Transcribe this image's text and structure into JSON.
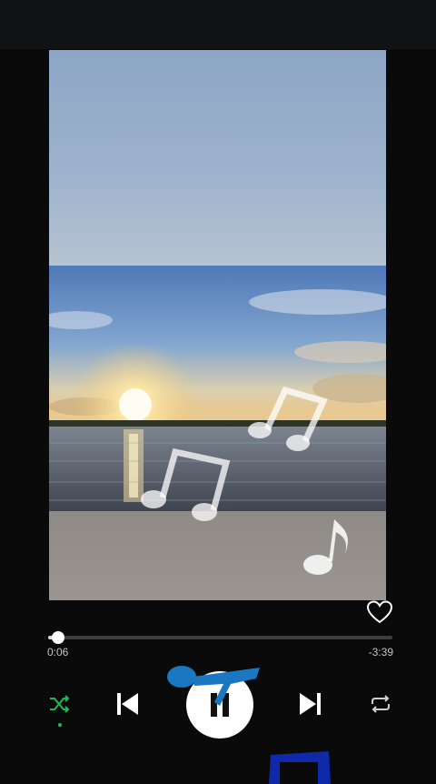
{
  "player": {
    "current_time": "0:06",
    "remaining_time": "-3:39",
    "progress_fraction": 0.029
  },
  "icons": {
    "like": "heart-outline-icon",
    "shuffle": "shuffle-icon",
    "previous": "skip-previous-icon",
    "play_pause": "pause-icon",
    "next": "skip-next-icon",
    "repeat": "repeat-icon"
  },
  "colors": {
    "accent_green": "#1db954",
    "background": "#0a0a0a"
  }
}
